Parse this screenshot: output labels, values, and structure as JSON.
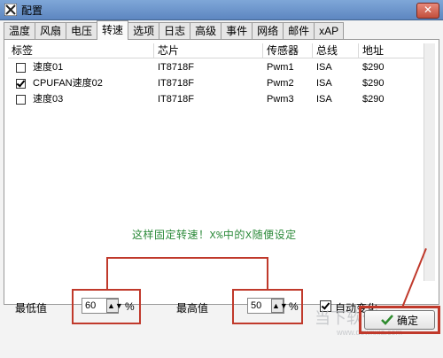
{
  "window": {
    "title": "配置"
  },
  "tabs": [
    "温度",
    "风扇",
    "电压",
    "转速",
    "选项",
    "日志",
    "高级",
    "事件",
    "网络",
    "邮件",
    "xAP"
  ],
  "active_tab": "转速",
  "table": {
    "headers": [
      "标签",
      "芯片",
      "传感器",
      "总线",
      "地址"
    ],
    "rows": [
      {
        "checked": false,
        "label": "速度01",
        "chip": "IT8718F",
        "sensor": "Pwm1",
        "bus": "ISA",
        "address": "$290"
      },
      {
        "checked": true,
        "label": "CPUFAN速度02",
        "chip": "IT8718F",
        "sensor": "Pwm2",
        "bus": "ISA",
        "address": "$290"
      },
      {
        "checked": false,
        "label": "速度03",
        "chip": "IT8718F",
        "sensor": "Pwm3",
        "bus": "ISA",
        "address": "$290"
      }
    ]
  },
  "annotation": {
    "text": "这样固定转速！X%中的X随便设定"
  },
  "controls": {
    "min_label": "最低值",
    "min_value": "60",
    "max_label": "最高值",
    "max_value": "50",
    "percent": "%",
    "auto_change_label": "自动变化",
    "auto_change_checked": true
  },
  "ok_button": {
    "label": "确定"
  },
  "watermark": {
    "text": "当下软件园",
    "url": "www.downxia.com"
  },
  "colors": {
    "annotation_green": "#2c8a3a",
    "highlight_red": "#c0392b",
    "titlebar": "#7fa7d8"
  }
}
